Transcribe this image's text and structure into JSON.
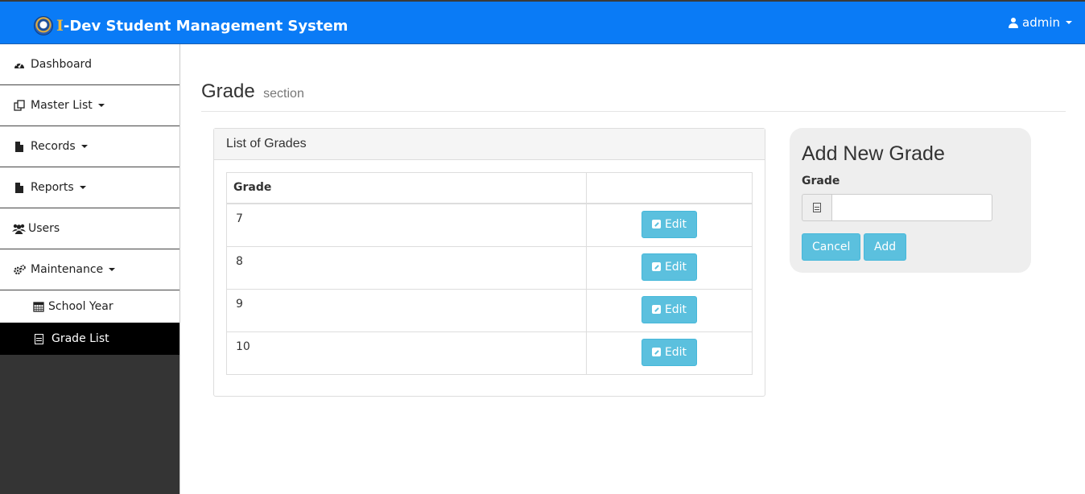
{
  "header": {
    "brand_initial": "I",
    "brand_rest": "-Dev Student Management System",
    "user_label": "admin"
  },
  "sidebar": {
    "items": [
      {
        "label": "Dashboard",
        "icon": "dashboard-icon"
      },
      {
        "label": "Master List",
        "icon": "copy-icon"
      },
      {
        "label": "Records",
        "icon": "file-icon"
      },
      {
        "label": "Reports",
        "icon": "file-icon"
      },
      {
        "label": "Users",
        "icon": "users-icon"
      },
      {
        "label": "Maintenance",
        "icon": "cogs-icon"
      }
    ],
    "subitems": [
      {
        "label": "School Year",
        "icon": "calendar-icon"
      },
      {
        "label": "Grade List",
        "icon": "file-text-icon",
        "active": true
      }
    ]
  },
  "page": {
    "title": "Grade",
    "subtitle": "section"
  },
  "grades_panel": {
    "heading": "List of Grades",
    "columns": [
      "Grade",
      ""
    ],
    "rows": [
      {
        "grade": "7",
        "action": "Edit"
      },
      {
        "grade": "8",
        "action": "Edit"
      },
      {
        "grade": "9",
        "action": "Edit"
      },
      {
        "grade": "10",
        "action": "Edit"
      }
    ]
  },
  "add_form": {
    "title": "Add New Grade",
    "field_label": "Grade",
    "field_value": "",
    "cancel_label": "Cancel",
    "add_label": "Add"
  },
  "colors": {
    "topbar": "#0a7bf6",
    "sidebar_bg": "#343434",
    "active_item": "#000000",
    "info_button": "#5bc0de"
  }
}
